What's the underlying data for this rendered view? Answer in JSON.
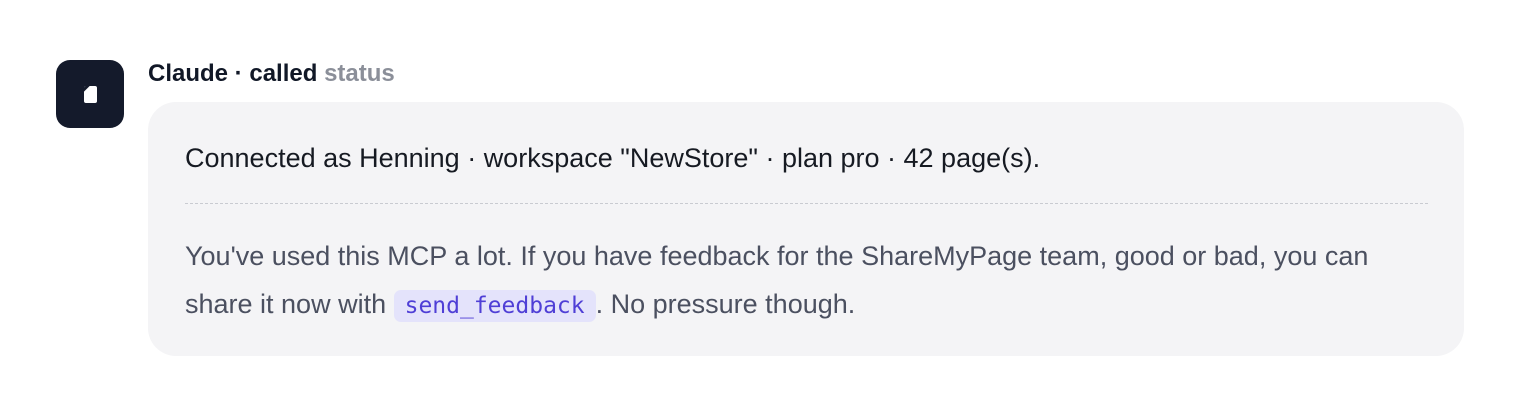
{
  "message": {
    "sender": "Claude",
    "separator": " · ",
    "action": "called",
    "tool_name": "status",
    "avatar_icon": "document-icon",
    "avatar_color": "#141a2b"
  },
  "card": {
    "status_text": "Connected as Henning · workspace \"NewStore\" · plan pro · 42 page(s).",
    "feedback_before": "You've used this MCP a lot. If you have feedback for the ShareMyPage team, good or bad, you can share it now with ",
    "feedback_code": "send_feedback",
    "feedback_after": ". No pressure though."
  }
}
